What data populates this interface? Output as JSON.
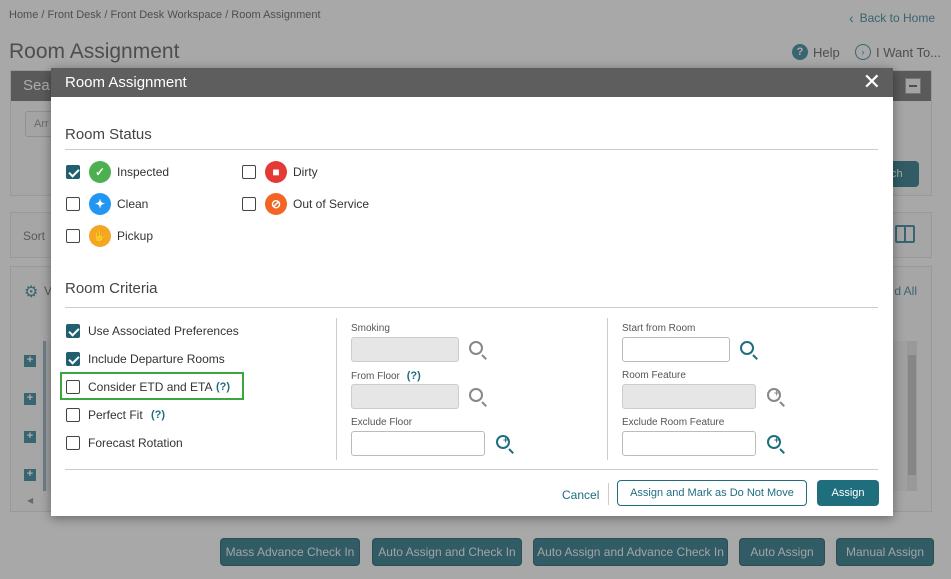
{
  "page": {
    "breadcrumb": "Home / Front Desk / Front Desk Workspace / Room Assignment",
    "back_home": "Back to Home",
    "title": "Room Assignment",
    "help": "Help",
    "i_want_to": "I Want To...",
    "search_header": "Sea",
    "arr_field": "Arr",
    "search_button": "ch",
    "sort_label": "Sort",
    "view_label": "V",
    "all_label": "d All"
  },
  "bottom_buttons": {
    "mass_advance": "Mass Advance Check In",
    "auto_assign_checkin": "Auto Assign and Check In",
    "auto_assign_advance": "Auto Assign and Advance Check In",
    "auto_assign": "Auto Assign",
    "manual_assign": "Manual Assign"
  },
  "modal": {
    "title": "Room Assignment",
    "close": "✕",
    "room_status": {
      "title": "Room Status",
      "items": {
        "inspected": {
          "label": "Inspected",
          "checked": true
        },
        "clean": {
          "label": "Clean",
          "checked": false
        },
        "pickup": {
          "label": "Pickup",
          "checked": false
        },
        "dirty": {
          "label": "Dirty",
          "checked": false
        },
        "out_of_service": {
          "label": "Out of Service",
          "checked": false
        }
      }
    },
    "room_criteria": {
      "title": "Room Criteria",
      "use_associated": {
        "label": "Use Associated Preferences",
        "checked": true
      },
      "include_departure": {
        "label": "Include Departure Rooms",
        "checked": true
      },
      "consider_etd": {
        "label": "Consider ETD and ETA",
        "help": "(?)",
        "checked": false
      },
      "perfect_fit": {
        "label": "Perfect Fit",
        "help": "(?)",
        "checked": false
      },
      "forecast_rotation": {
        "label": "Forecast Rotation",
        "checked": false
      },
      "smoking": {
        "label": "Smoking",
        "value": ""
      },
      "from_floor": {
        "label": "From Floor",
        "help": "(?)",
        "value": ""
      },
      "exclude_floor": {
        "label": "Exclude Floor",
        "value": ""
      },
      "start_from_room": {
        "label": "Start from Room",
        "value": ""
      },
      "room_feature": {
        "label": "Room Feature",
        "value": ""
      },
      "exclude_room_feature": {
        "label": "Exclude Room Feature",
        "value": ""
      }
    },
    "footer": {
      "cancel": "Cancel",
      "assign_mark": "Assign and Mark as Do Not Move",
      "assign": "Assign"
    }
  },
  "colors": {
    "accent": "#1f6e7e",
    "inspected": "#4caf50",
    "clean": "#2196f3",
    "pickup": "#f5a623",
    "dirty": "#e53935",
    "out_of_service": "#f26522",
    "highlight": "#3aa541"
  }
}
